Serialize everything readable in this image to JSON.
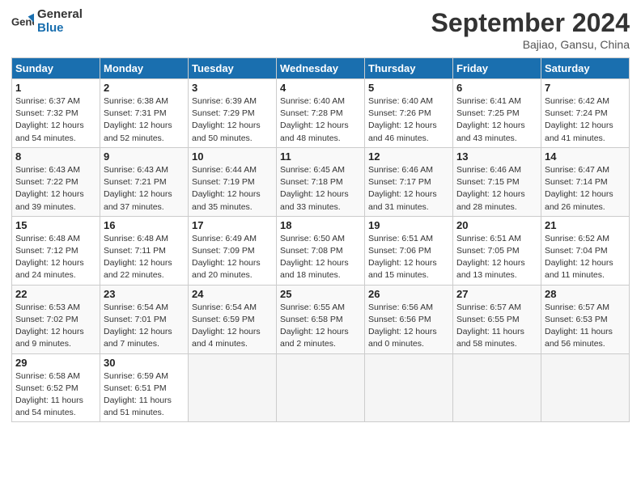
{
  "header": {
    "logo_text_general": "General",
    "logo_text_blue": "Blue",
    "month_title": "September 2024",
    "subtitle": "Bajiao, Gansu, China"
  },
  "days_of_week": [
    "Sunday",
    "Monday",
    "Tuesday",
    "Wednesday",
    "Thursday",
    "Friday",
    "Saturday"
  ],
  "weeks": [
    [
      {
        "day": "1",
        "sunrise": "6:37 AM",
        "sunset": "7:32 PM",
        "daylight": "12 hours and 54 minutes."
      },
      {
        "day": "2",
        "sunrise": "6:38 AM",
        "sunset": "7:31 PM",
        "daylight": "12 hours and 52 minutes."
      },
      {
        "day": "3",
        "sunrise": "6:39 AM",
        "sunset": "7:29 PM",
        "daylight": "12 hours and 50 minutes."
      },
      {
        "day": "4",
        "sunrise": "6:40 AM",
        "sunset": "7:28 PM",
        "daylight": "12 hours and 48 minutes."
      },
      {
        "day": "5",
        "sunrise": "6:40 AM",
        "sunset": "7:26 PM",
        "daylight": "12 hours and 46 minutes."
      },
      {
        "day": "6",
        "sunrise": "6:41 AM",
        "sunset": "7:25 PM",
        "daylight": "12 hours and 43 minutes."
      },
      {
        "day": "7",
        "sunrise": "6:42 AM",
        "sunset": "7:24 PM",
        "daylight": "12 hours and 41 minutes."
      }
    ],
    [
      {
        "day": "8",
        "sunrise": "6:43 AM",
        "sunset": "7:22 PM",
        "daylight": "12 hours and 39 minutes."
      },
      {
        "day": "9",
        "sunrise": "6:43 AM",
        "sunset": "7:21 PM",
        "daylight": "12 hours and 37 minutes."
      },
      {
        "day": "10",
        "sunrise": "6:44 AM",
        "sunset": "7:19 PM",
        "daylight": "12 hours and 35 minutes."
      },
      {
        "day": "11",
        "sunrise": "6:45 AM",
        "sunset": "7:18 PM",
        "daylight": "12 hours and 33 minutes."
      },
      {
        "day": "12",
        "sunrise": "6:46 AM",
        "sunset": "7:17 PM",
        "daylight": "12 hours and 31 minutes."
      },
      {
        "day": "13",
        "sunrise": "6:46 AM",
        "sunset": "7:15 PM",
        "daylight": "12 hours and 28 minutes."
      },
      {
        "day": "14",
        "sunrise": "6:47 AM",
        "sunset": "7:14 PM",
        "daylight": "12 hours and 26 minutes."
      }
    ],
    [
      {
        "day": "15",
        "sunrise": "6:48 AM",
        "sunset": "7:12 PM",
        "daylight": "12 hours and 24 minutes."
      },
      {
        "day": "16",
        "sunrise": "6:48 AM",
        "sunset": "7:11 PM",
        "daylight": "12 hours and 22 minutes."
      },
      {
        "day": "17",
        "sunrise": "6:49 AM",
        "sunset": "7:09 PM",
        "daylight": "12 hours and 20 minutes."
      },
      {
        "day": "18",
        "sunrise": "6:50 AM",
        "sunset": "7:08 PM",
        "daylight": "12 hours and 18 minutes."
      },
      {
        "day": "19",
        "sunrise": "6:51 AM",
        "sunset": "7:06 PM",
        "daylight": "12 hours and 15 minutes."
      },
      {
        "day": "20",
        "sunrise": "6:51 AM",
        "sunset": "7:05 PM",
        "daylight": "12 hours and 13 minutes."
      },
      {
        "day": "21",
        "sunrise": "6:52 AM",
        "sunset": "7:04 PM",
        "daylight": "12 hours and 11 minutes."
      }
    ],
    [
      {
        "day": "22",
        "sunrise": "6:53 AM",
        "sunset": "7:02 PM",
        "daylight": "12 hours and 9 minutes."
      },
      {
        "day": "23",
        "sunrise": "6:54 AM",
        "sunset": "7:01 PM",
        "daylight": "12 hours and 7 minutes."
      },
      {
        "day": "24",
        "sunrise": "6:54 AM",
        "sunset": "6:59 PM",
        "daylight": "12 hours and 4 minutes."
      },
      {
        "day": "25",
        "sunrise": "6:55 AM",
        "sunset": "6:58 PM",
        "daylight": "12 hours and 2 minutes."
      },
      {
        "day": "26",
        "sunrise": "6:56 AM",
        "sunset": "6:56 PM",
        "daylight": "12 hours and 0 minutes."
      },
      {
        "day": "27",
        "sunrise": "6:57 AM",
        "sunset": "6:55 PM",
        "daylight": "11 hours and 58 minutes."
      },
      {
        "day": "28",
        "sunrise": "6:57 AM",
        "sunset": "6:53 PM",
        "daylight": "11 hours and 56 minutes."
      }
    ],
    [
      {
        "day": "29",
        "sunrise": "6:58 AM",
        "sunset": "6:52 PM",
        "daylight": "11 hours and 54 minutes."
      },
      {
        "day": "30",
        "sunrise": "6:59 AM",
        "sunset": "6:51 PM",
        "daylight": "11 hours and 51 minutes."
      },
      null,
      null,
      null,
      null,
      null
    ]
  ]
}
